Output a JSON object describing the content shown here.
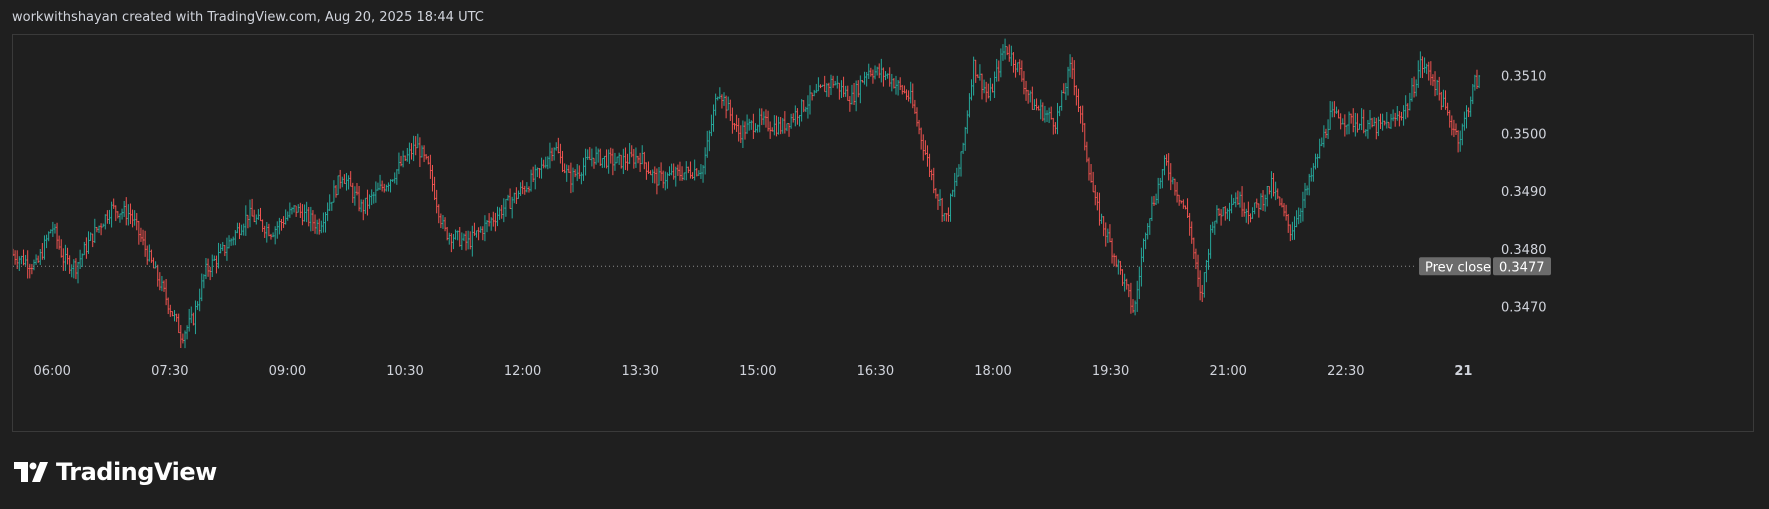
{
  "header": {
    "text": "workwithshayan created with TradingView.com, Aug 20, 2025 18:44 UTC"
  },
  "brand": {
    "name": "TradingView",
    "logo_icon": "tradingview-logo-icon"
  },
  "colors": {
    "up": "#26a69a",
    "down": "#ef5350",
    "background": "#1f1f1f",
    "badge": "#6b6b6b",
    "grid_border": "#3a3a3a",
    "text": "#d1d4dc"
  },
  "chart_data": {
    "type": "ohlc",
    "ylim": [
      0.3462,
      0.3517
    ],
    "y_ticks": [
      "0.3510",
      "0.3500",
      "0.3490",
      "0.3480",
      "0.3470"
    ],
    "x_ticks": [
      "06:00",
      "07:30",
      "09:00",
      "10:30",
      "12:00",
      "13:30",
      "15:00",
      "16:30",
      "18:00",
      "19:30",
      "21:00",
      "22:30",
      "21"
    ],
    "x_tick_hours": [
      6,
      7.5,
      9,
      10.5,
      12,
      13.5,
      15,
      16.5,
      18,
      19.5,
      21,
      22.5,
      24
    ],
    "x_start_hour": 5.5,
    "x_end_hour": 24.25,
    "prev_close": {
      "label": "Prev close",
      "value": "0.3477"
    },
    "close_path": [
      [
        5.5,
        0.3479
      ],
      [
        5.8,
        0.3477
      ],
      [
        6.0,
        0.3484
      ],
      [
        6.15,
        0.3478
      ],
      [
        6.3,
        0.3477
      ],
      [
        6.5,
        0.3482
      ],
      [
        6.75,
        0.3487
      ],
      [
        7.0,
        0.3486
      ],
      [
        7.25,
        0.3478
      ],
      [
        7.5,
        0.347
      ],
      [
        7.65,
        0.3465
      ],
      [
        7.8,
        0.3468
      ],
      [
        7.95,
        0.3476
      ],
      [
        8.2,
        0.348
      ],
      [
        8.5,
        0.3486
      ],
      [
        8.8,
        0.3483
      ],
      [
        9.1,
        0.3487
      ],
      [
        9.4,
        0.3484
      ],
      [
        9.7,
        0.3493
      ],
      [
        9.95,
        0.3487
      ],
      [
        10.3,
        0.3492
      ],
      [
        10.65,
        0.3498
      ],
      [
        10.8,
        0.3494
      ],
      [
        11.0,
        0.3483
      ],
      [
        11.3,
        0.3481
      ],
      [
        11.6,
        0.3485
      ],
      [
        11.9,
        0.3489
      ],
      [
        12.2,
        0.3493
      ],
      [
        12.4,
        0.3498
      ],
      [
        12.6,
        0.3492
      ],
      [
        12.9,
        0.3496
      ],
      [
        13.2,
        0.3495
      ],
      [
        13.5,
        0.3496
      ],
      [
        13.7,
        0.3492
      ],
      [
        14.0,
        0.3493
      ],
      [
        14.3,
        0.3494
      ],
      [
        14.5,
        0.3508
      ],
      [
        14.75,
        0.35
      ],
      [
        15.0,
        0.3502
      ],
      [
        15.3,
        0.3501
      ],
      [
        15.6,
        0.3505
      ],
      [
        15.95,
        0.3509
      ],
      [
        16.2,
        0.3506
      ],
      [
        16.4,
        0.3511
      ],
      [
        16.65,
        0.351
      ],
      [
        16.95,
        0.3506
      ],
      [
        17.25,
        0.3491
      ],
      [
        17.4,
        0.3485
      ],
      [
        17.6,
        0.3496
      ],
      [
        17.75,
        0.3512
      ],
      [
        17.95,
        0.3506
      ],
      [
        18.15,
        0.3515
      ],
      [
        18.3,
        0.3512
      ],
      [
        18.5,
        0.3505
      ],
      [
        18.8,
        0.3502
      ],
      [
        19.0,
        0.3512
      ],
      [
        19.3,
        0.3488
      ],
      [
        19.6,
        0.3477
      ],
      [
        19.8,
        0.3469
      ],
      [
        19.95,
        0.3484
      ],
      [
        20.2,
        0.3495
      ],
      [
        20.5,
        0.3485
      ],
      [
        20.65,
        0.3471
      ],
      [
        20.8,
        0.3485
      ],
      [
        21.1,
        0.3489
      ],
      [
        21.3,
        0.3486
      ],
      [
        21.55,
        0.3491
      ],
      [
        21.8,
        0.3483
      ],
      [
        22.0,
        0.349
      ],
      [
        22.3,
        0.3503
      ],
      [
        22.6,
        0.3502
      ],
      [
        22.9,
        0.3501
      ],
      [
        23.1,
        0.3502
      ],
      [
        23.3,
        0.3505
      ],
      [
        23.45,
        0.3512
      ],
      [
        23.6,
        0.351
      ],
      [
        23.8,
        0.3503
      ],
      [
        23.95,
        0.3499
      ],
      [
        24.15,
        0.3509
      ]
    ]
  }
}
